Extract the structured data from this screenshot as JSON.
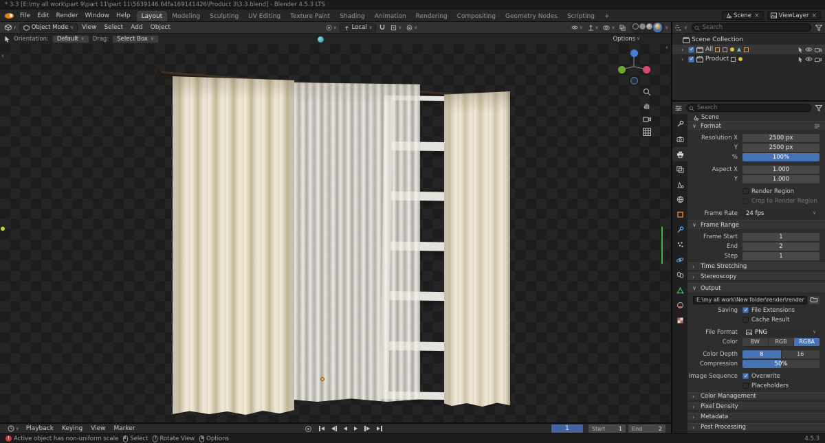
{
  "window_title": "* 3.3 [E:\\my all work\\part 9\\part 11\\part 11\\5639146.64fa169141426\\Product 3\\3.3.blend] - Blender 4.5.3 LTS",
  "topbar": {
    "menus": [
      "File",
      "Edit",
      "Render",
      "Window",
      "Help"
    ],
    "tabs": [
      "Layout",
      "Modeling",
      "Sculpting",
      "UV Editing",
      "Texture Paint",
      "Shading",
      "Animation",
      "Rendering",
      "Compositing",
      "Geometry Nodes",
      "Scripting",
      "+"
    ],
    "scene_label": "Scene",
    "viewlayer_label": "ViewLayer"
  },
  "viewport_header": {
    "mode": "Object Mode",
    "menus": [
      "View",
      "Select",
      "Add",
      "Object"
    ],
    "orientation": "Local",
    "options": "Options"
  },
  "tool_settings": {
    "orientation_label": "Orientation:",
    "orientation_value": "Default",
    "drag_label": "Drag:",
    "drag_value": "Select Box"
  },
  "outliner": {
    "search_placeholder": "Search",
    "root": "Scene Collection",
    "collections": [
      {
        "name": "All"
      },
      {
        "name": "Product"
      }
    ]
  },
  "properties": {
    "search_placeholder": "Search",
    "breadcrumb": "Scene",
    "sections": {
      "format": "Format",
      "frame_range": "Frame Range",
      "time_stretching": "Time Stretching",
      "stereoscopy": "Stereoscopy",
      "output": "Output",
      "color_management": "Color Management",
      "pixel_density": "Pixel Density",
      "metadata": "Metadata",
      "post_processing": "Post Processing"
    },
    "format": {
      "labels": {
        "resolution_x": "Resolution X",
        "resolution_y": "Y",
        "percent": "%",
        "aspect_x": "Aspect X",
        "aspect_y": "Y",
        "render_region": "Render Region",
        "crop": "Crop to Render Region",
        "frame_rate": "Frame Rate"
      },
      "values": {
        "resolution_x": "2500 px",
        "resolution_y": "2500 px",
        "percent": "100%",
        "aspect_x": "1.000",
        "aspect_y": "1.000",
        "frame_rate": "24 fps"
      }
    },
    "frame_range": {
      "labels": {
        "start": "Frame Start",
        "end": "End",
        "step": "Step"
      },
      "values": {
        "start": "1",
        "end": "2",
        "step": "1"
      }
    },
    "output": {
      "path": "E:\\my all work\\New folder\\render\\render",
      "labels": {
        "saving": "Saving",
        "file_format": "File Format",
        "color": "Color",
        "color_depth": "Color Depth",
        "compression": "Compression",
        "image_sequence": "Image Sequence"
      },
      "checkboxes": {
        "file_extensions": "File Extensions",
        "cache_result": "Cache Result",
        "overwrite": "Overwrite",
        "placeholders": "Placeholders"
      },
      "values": {
        "file_format": "PNG",
        "compression": "50%"
      },
      "color_options": [
        "BW",
        "RGB",
        "RGBA"
      ],
      "depth_options": [
        "8",
        "16"
      ]
    }
  },
  "timeline": {
    "menus": [
      "Playback",
      "Keying",
      "View",
      "Marker"
    ],
    "current_frame": "1",
    "start_label": "Start",
    "start_value": "1",
    "end_label": "End",
    "end_value": "2"
  },
  "statusbar": {
    "warning": "Active object has non-uniform scale",
    "hints": [
      "Select",
      "Rotate View",
      "Options"
    ],
    "version": "4.5.3"
  },
  "colors": {
    "accent": "#4772b3",
    "curtain": "#e7dfcb",
    "axis_x": "#d6486d",
    "axis_y": "#6ba733",
    "axis_z": "#3f7fd6"
  }
}
